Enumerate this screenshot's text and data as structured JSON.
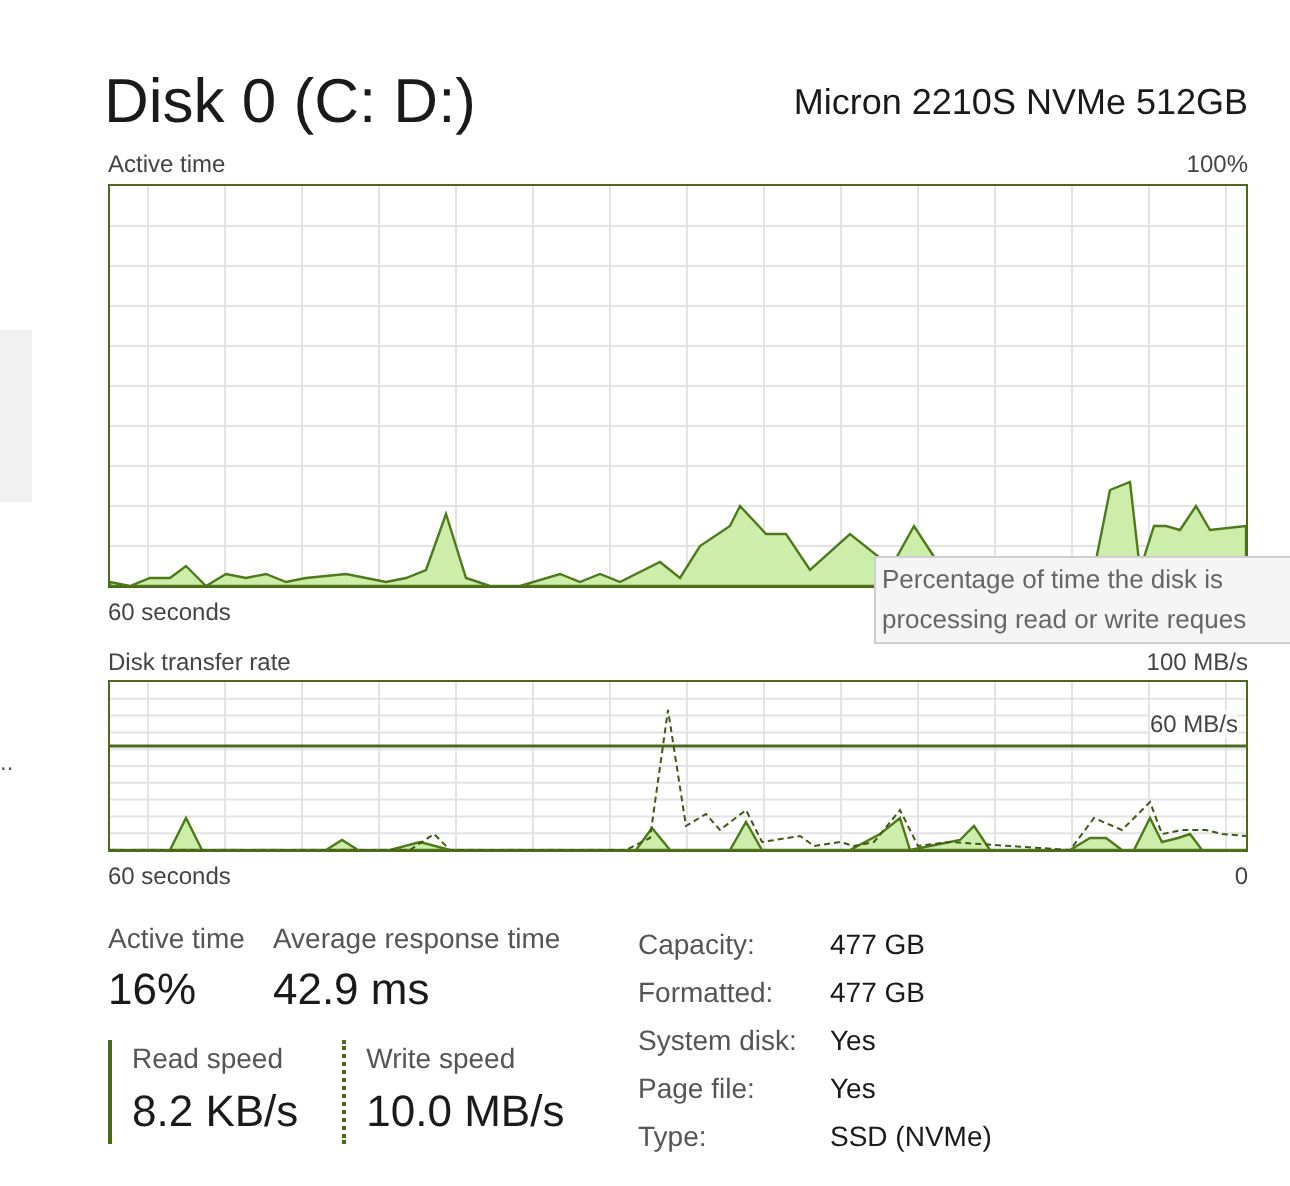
{
  "disk": {
    "title": "Disk 0 (C: D:)",
    "model": "Micron 2210S NVMe 512GB"
  },
  "sidebar": {
    "fragment": ".."
  },
  "active_time_graph": {
    "label": "Active time",
    "max": "100%",
    "time_span": "60 seconds"
  },
  "tooltip": {
    "lines": [
      "Percentage of time the disk is",
      "processing read or write reques"
    ]
  },
  "transfer_rate_graph": {
    "label": "Disk transfer rate",
    "max": "100 MB/s",
    "scale_line": "60 MB/s",
    "time_span": "60 seconds",
    "min": "0"
  },
  "stats": [
    {
      "label": "Active time",
      "value": "16%"
    },
    {
      "label": "Average response time",
      "value": "42.9 ms"
    }
  ],
  "speeds": [
    {
      "label": "Read speed",
      "value": "8.2 KB/s",
      "kind": "read"
    },
    {
      "label": "Write speed",
      "value": "10.0 MB/s",
      "kind": "write"
    }
  ],
  "properties": [
    {
      "label": "Capacity:",
      "value": "477 GB"
    },
    {
      "label": "Formatted:",
      "value": "477 GB"
    },
    {
      "label": "System disk:",
      "value": "Yes"
    },
    {
      "label": "Page file:",
      "value": "Yes"
    },
    {
      "label": "Type:",
      "value": "SSD (NVMe)"
    }
  ]
}
